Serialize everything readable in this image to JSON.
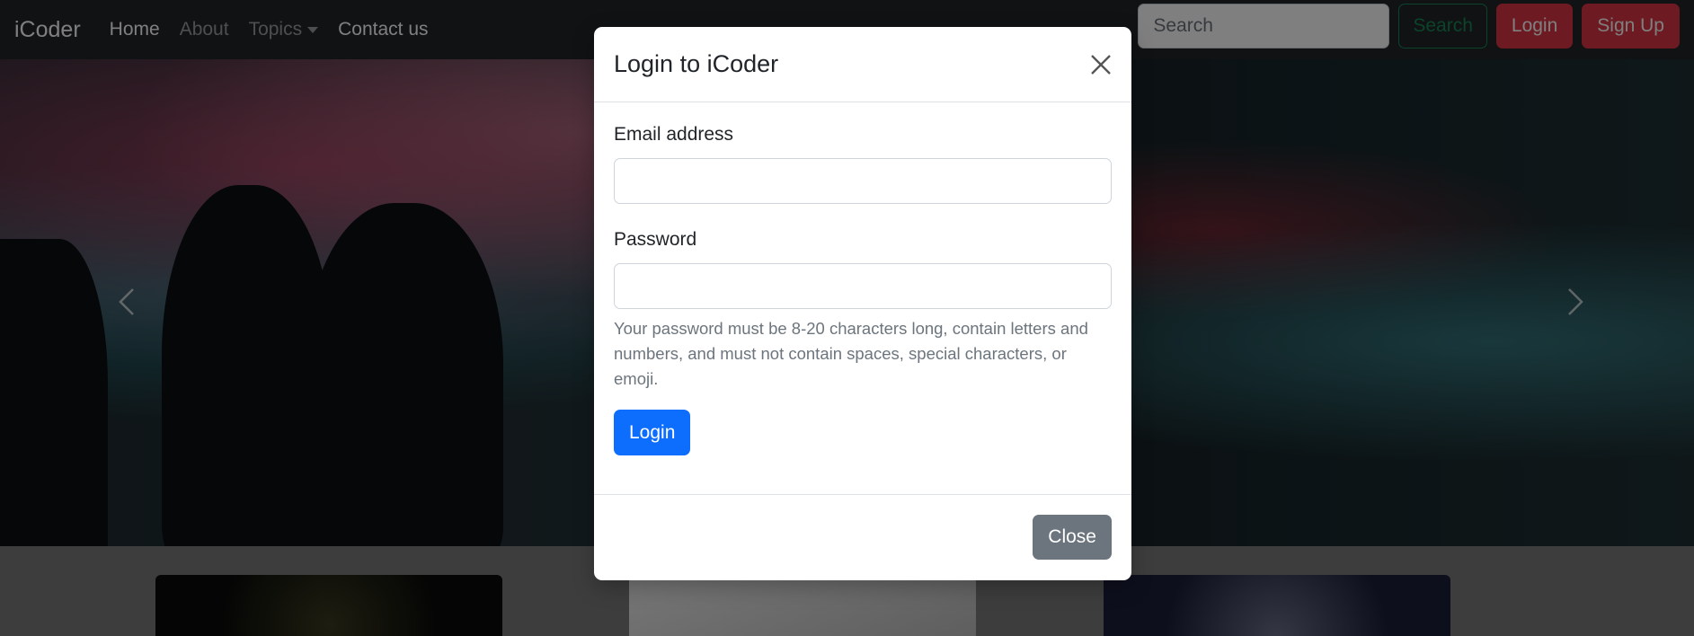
{
  "navbar": {
    "brand": "iCoder",
    "links": [
      {
        "label": "Home"
      },
      {
        "label": "About"
      },
      {
        "label": "Topics"
      },
      {
        "label": "Contact us"
      }
    ],
    "search_placeholder": "Search",
    "search_button": "Search",
    "login_button": "Login",
    "signup_button": "Sign Up"
  },
  "modal": {
    "title": "Login to iCoder",
    "email_label": "Email address",
    "email_value": "",
    "password_label": "Password",
    "password_value": "",
    "password_help": "Your password must be 8-20 characters long, contain letters and numbers, and must not contain spaces, special characters, or emoji.",
    "submit_label": "Login",
    "close_label": "Close"
  },
  "icons": {
    "close": "close-icon",
    "prev": "chevron-left-icon",
    "next": "chevron-right-icon",
    "dropdown": "caret-down-icon"
  },
  "colors": {
    "navbar_bg": "#212529",
    "primary": "#0d6efd",
    "danger": "#dc3545",
    "success": "#198754",
    "secondary": "#6c757d"
  }
}
